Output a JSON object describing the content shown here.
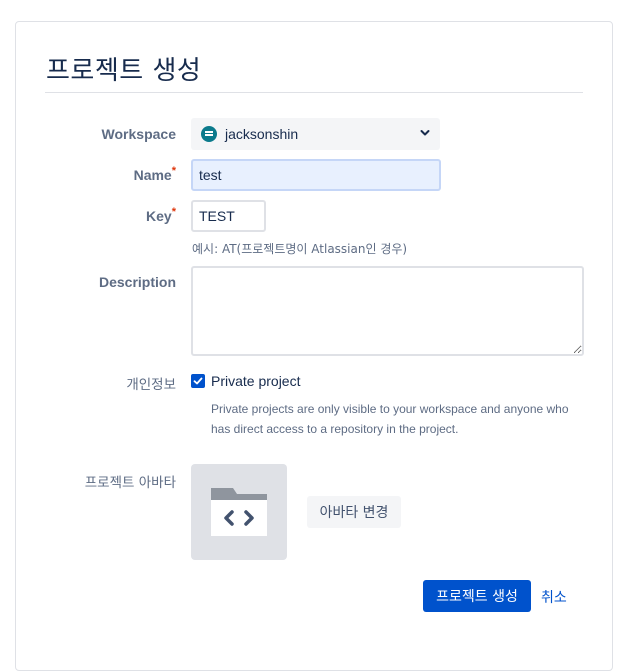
{
  "page": {
    "title": "프로젝트 생성"
  },
  "form": {
    "workspace": {
      "label": "Workspace",
      "value": "jacksonshin"
    },
    "name": {
      "label": "Name",
      "required_mark": "*",
      "value": "test"
    },
    "key": {
      "label": "Key",
      "required_mark": "*",
      "value": "TEST",
      "hint": "예시: AT(프로젝트명이 Atlassian인 경우)"
    },
    "description": {
      "label": "Description",
      "value": ""
    },
    "privacy": {
      "label": "개인정보",
      "checkbox_label": "Private project",
      "checked": true,
      "help": "Private projects are only visible to your workspace and anyone who has direct access to a repository in the project."
    },
    "avatar": {
      "label": "프로젝트 아바타",
      "change_label": "아바타 변경"
    }
  },
  "actions": {
    "create_label": "프로젝트 생성",
    "cancel_label": "취소"
  },
  "colors": {
    "primary": "#0052cc",
    "required": "#de350b",
    "autofill": "#e8f0fe"
  }
}
